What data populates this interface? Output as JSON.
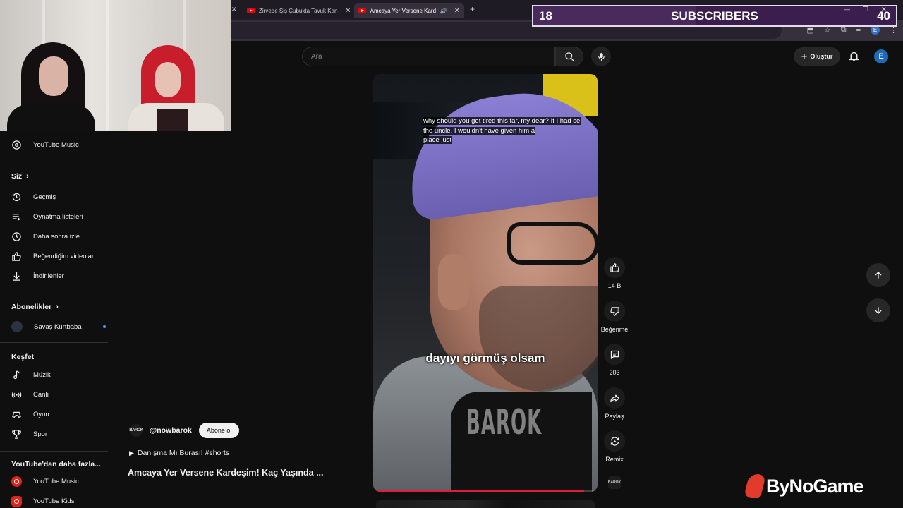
{
  "browser": {
    "tabs": [
      {
        "label": "Zirvede Şiş Çubukta Tavuk Kanad",
        "active": false
      },
      {
        "label": "Amcaya Yer Versene Kardeşi",
        "active": true
      }
    ],
    "new_tab": "+",
    "profile_initial": "E"
  },
  "subs_overlay": {
    "current": "18",
    "label": "SUBSCRIBERS",
    "goal": "40",
    "progress_fraction": 0.45
  },
  "header": {
    "search_placeholder": "Ara",
    "create_label": "Oluştur",
    "avatar_initial": "E"
  },
  "sidebar": {
    "music_item": "YouTube Music",
    "you_heading": "Siz",
    "you_items": [
      "Geçmiş",
      "Oynatma listeleri",
      "Daha sonra izle",
      "Beğendiğim videolar",
      "İndirilenler"
    ],
    "subs_heading": "Abonelikler",
    "subs_items": [
      "Savaş Kurtbaba"
    ],
    "explore_heading": "Keşfet",
    "explore_items": [
      "Müzik",
      "Canlı",
      "Oyun",
      "Spor"
    ],
    "more_heading": "YouTube'dan daha fazla...",
    "more_items": [
      "YouTube Music",
      "YouTube Kids"
    ]
  },
  "short": {
    "caption_top": "why should you get tired this far, my dear?  If I had se the uncle, I wouldn't have given him a place just",
    "caption_line1": "why should you get tired this far, my dear?  If I had se",
    "caption_line2": "the uncle, I wouldn't have given him a",
    "caption_line3": "place just",
    "caption_mid": "dayıyı görmüş olsam",
    "watermark": "BAROK",
    "progress_fraction": 0.94,
    "channel_handle": "@nowbarok",
    "channel_icon_text": "BAROK",
    "subscribe_label": "Abone ol",
    "playlist_label": "Danışma Mı Burası! #shorts",
    "title": "Amcaya Yer Versene Kardeşim! Kaç Yaşında ..."
  },
  "actions": {
    "like_count": "14 B",
    "dislike_label": "Beğenme",
    "comment_count": "203",
    "share_label": "Paylaş",
    "remix_label": "Remix"
  },
  "branding": {
    "sponsor": "ByNoGame"
  },
  "colors": {
    "accent_red": "#e11c3c",
    "overlay_purple": "#3b1e4d",
    "avatar_blue": "#1e6bb8"
  }
}
